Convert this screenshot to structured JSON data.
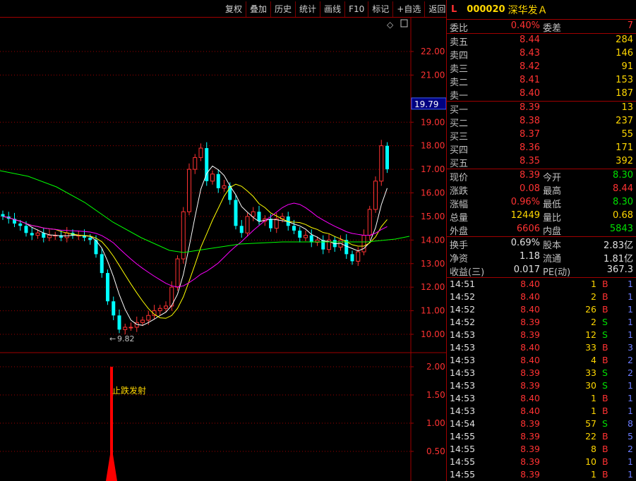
{
  "toolbar": [
    "复权",
    "叠加",
    "历史",
    "统计",
    "画线",
    "F10",
    "标记",
    "+自选",
    "返回"
  ],
  "stock": {
    "flag": "L",
    "code": "000020",
    "name": "深华发Ａ"
  },
  "axis": {
    "price_ticks": [
      "22.00",
      "21.00",
      "19.79",
      "19.00",
      "18.00",
      "17.00",
      "16.00",
      "15.00",
      "14.00",
      "13.00",
      "12.00",
      "11.00",
      "10.00"
    ],
    "indicator_ticks": [
      "2.00",
      "1.50",
      "1.00",
      "0.50"
    ],
    "current_price_label": "19.79",
    "low_marker": "9.82",
    "signal_label": "止跌发射"
  },
  "weibi": {
    "label": "委比",
    "value": "0.40%",
    "label2": "委差",
    "value2": "7"
  },
  "asks": [
    {
      "label": "卖五",
      "price": "8.44",
      "vol": "284"
    },
    {
      "label": "卖四",
      "price": "8.43",
      "vol": "146"
    },
    {
      "label": "卖三",
      "price": "8.42",
      "vol": "91"
    },
    {
      "label": "卖二",
      "price": "8.41",
      "vol": "153"
    },
    {
      "label": "卖一",
      "price": "8.40",
      "vol": "187"
    }
  ],
  "bids": [
    {
      "label": "买一",
      "price": "8.39",
      "vol": "13"
    },
    {
      "label": "买二",
      "price": "8.38",
      "vol": "237"
    },
    {
      "label": "买三",
      "price": "8.37",
      "vol": "55"
    },
    {
      "label": "买四",
      "price": "8.36",
      "vol": "171"
    },
    {
      "label": "买五",
      "price": "8.35",
      "vol": "392"
    }
  ],
  "quote": [
    {
      "l1": "现价",
      "v1": "8.39",
      "l2": "今开",
      "v2": "8.30",
      "c1": "red",
      "c2": "grn"
    },
    {
      "l1": "涨跌",
      "v1": "0.08",
      "l2": "最高",
      "v2": "8.44",
      "c1": "red",
      "c2": "red"
    },
    {
      "l1": "涨幅",
      "v1": "0.96%",
      "l2": "最低",
      "v2": "8.30",
      "c1": "red",
      "c2": "grn"
    },
    {
      "l1": "总量",
      "v1": "12449",
      "l2": "量比",
      "v2": "0.68",
      "c1": "ylw",
      "c2": "ylw"
    },
    {
      "l1": "外盘",
      "v1": "6606",
      "l2": "内盘",
      "v2": "5843",
      "c1": "red",
      "c2": "grn"
    }
  ],
  "stats": [
    {
      "l1": "换手",
      "v1": "0.69%",
      "l2": "股本",
      "v2": "2.83亿"
    },
    {
      "l1": "净资",
      "v1": "1.18",
      "l2": "流通",
      "v2": "1.81亿"
    },
    {
      "l1": "收益(三)",
      "v1": "0.017",
      "l2": "PE(动)",
      "v2": "367.3"
    }
  ],
  "ticks": [
    {
      "t": "14:51",
      "p": "8.40",
      "v": "1",
      "s": "B",
      "n": "1"
    },
    {
      "t": "14:52",
      "p": "8.40",
      "v": "2",
      "s": "B",
      "n": "1"
    },
    {
      "t": "14:52",
      "p": "8.40",
      "v": "26",
      "s": "B",
      "n": "1"
    },
    {
      "t": "14:52",
      "p": "8.39",
      "v": "2",
      "s": "S",
      "n": "1"
    },
    {
      "t": "14:53",
      "p": "8.39",
      "v": "12",
      "s": "S",
      "n": "1"
    },
    {
      "t": "14:53",
      "p": "8.40",
      "v": "33",
      "s": "B",
      "n": "3"
    },
    {
      "t": "14:53",
      "p": "8.40",
      "v": "4",
      "s": "B",
      "n": "2"
    },
    {
      "t": "14:53",
      "p": "8.39",
      "v": "33",
      "s": "S",
      "n": "2"
    },
    {
      "t": "14:53",
      "p": "8.39",
      "v": "30",
      "s": "S",
      "n": "1"
    },
    {
      "t": "14:53",
      "p": "8.40",
      "v": "1",
      "s": "B",
      "n": "1"
    },
    {
      "t": "14:53",
      "p": "8.40",
      "v": "1",
      "s": "B",
      "n": "1"
    },
    {
      "t": "14:54",
      "p": "8.39",
      "v": "57",
      "s": "S",
      "n": "8"
    },
    {
      "t": "14:55",
      "p": "8.39",
      "v": "22",
      "s": "B",
      "n": "5"
    },
    {
      "t": "14:55",
      "p": "8.39",
      "v": "8",
      "s": "B",
      "n": "2"
    },
    {
      "t": "14:55",
      "p": "8.39",
      "v": "10",
      "s": "B",
      "n": "1"
    },
    {
      "t": "14:55",
      "p": "8.39",
      "v": "1",
      "s": "B",
      "n": "1"
    }
  ],
  "colors": {
    "up": "#ff3232",
    "down": "#00ffff",
    "ma5": "#ffffff",
    "ma10": "#ffff00",
    "ma20": "#ff00ff",
    "ma60": "#00ff00",
    "grid": "#a00000"
  }
}
